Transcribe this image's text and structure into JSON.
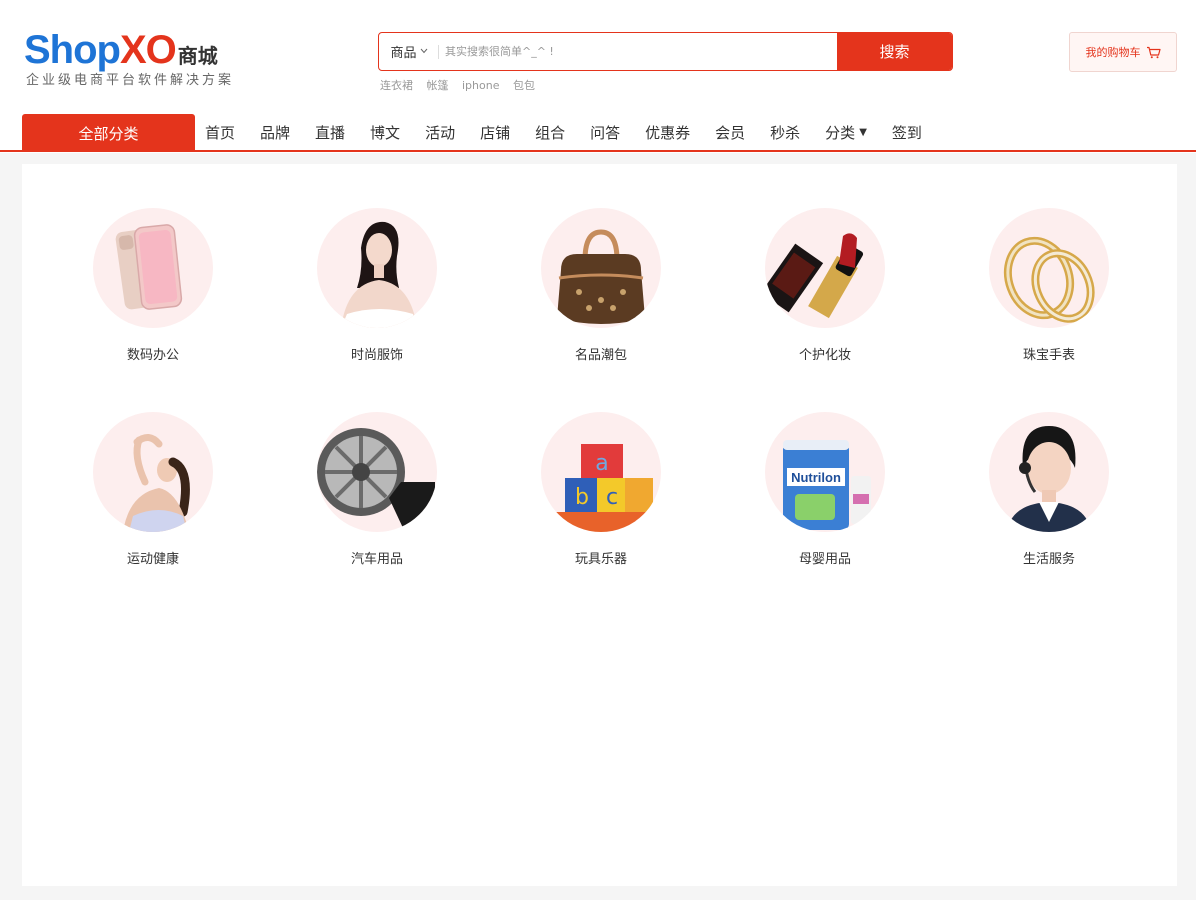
{
  "logo": {
    "brand_a": "Shop",
    "brand_b": "XO",
    "brand_c": "商城",
    "tagline": "企业级电商平台软件解决方案"
  },
  "search": {
    "type_label": "商品",
    "placeholder": "其实搜索很简单^_^ !",
    "value": "",
    "button_label": "搜索"
  },
  "hot_words": [
    "连衣裙",
    "帐篷",
    "iphone",
    "包包"
  ],
  "cart": {
    "label": "我的购物车"
  },
  "nav": {
    "all_categories": "全部分类",
    "items": [
      "首页",
      "品牌",
      "直播",
      "博文",
      "活动",
      "店铺",
      "组合",
      "问答",
      "优惠券",
      "会员",
      "秒杀",
      "分类",
      "签到"
    ]
  },
  "categories": [
    {
      "label": "数码办公",
      "icon": "phone-icon"
    },
    {
      "label": "时尚服饰",
      "icon": "fashion-model-icon"
    },
    {
      "label": "名品潮包",
      "icon": "handbag-icon"
    },
    {
      "label": "个护化妆",
      "icon": "lipstick-icon"
    },
    {
      "label": "珠宝手表",
      "icon": "rings-icon"
    },
    {
      "label": "运动健康",
      "icon": "yoga-icon"
    },
    {
      "label": "汽车用品",
      "icon": "wheel-icon"
    },
    {
      "label": "玩具乐器",
      "icon": "toy-blocks-icon"
    },
    {
      "label": "母婴用品",
      "icon": "milk-powder-icon"
    },
    {
      "label": "生活服务",
      "icon": "customer-service-icon"
    }
  ],
  "colors": {
    "brand_red": "#e4341c",
    "brand_blue": "#1e74d6",
    "circle_bg": "#fdeeee"
  }
}
